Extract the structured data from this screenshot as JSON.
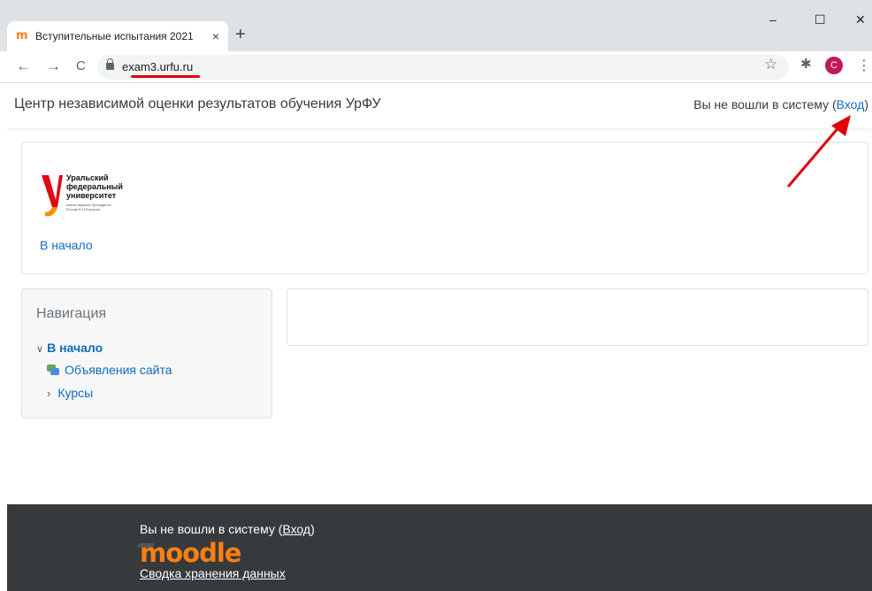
{
  "browser": {
    "tab_title": "Вступительные испытания 2021",
    "tab_favicon": "m",
    "url": "exam3.urfu.ru",
    "profile_initial": "C",
    "win_minimize": "–",
    "win_maximize": "☐",
    "win_close": "✕",
    "nav_back": "←",
    "nav_forward": "→",
    "nav_reload": "C",
    "new_tab": "+",
    "tab_close": "×",
    "star": "☆",
    "extensions": "✱",
    "menu": "⋮"
  },
  "header": {
    "site_title": "Центр независимой оценки результатов обучения УрФУ",
    "login_prefix": "Вы не вошли в систему (",
    "login_link": "Вход",
    "login_suffix": ")"
  },
  "hero": {
    "logo_line1": "Уральский",
    "logo_line2": "федеральный",
    "logo_line3": "университет",
    "logo_small1": "имени первого Президента",
    "logo_small2": "России Б.Н.Ельцина",
    "home_link": "В начало"
  },
  "navigation": {
    "title": "Навигация",
    "home": "В начало",
    "items": [
      {
        "label": "Объявления сайта"
      },
      {
        "label": "Курсы"
      }
    ]
  },
  "footer": {
    "login_prefix": "Вы не вошли в систему (",
    "login_link": "Вход",
    "login_suffix": ")",
    "moodle": "moodle",
    "data_link": "Сводка хранения данных"
  },
  "colors": {
    "link": "#0f6cbf",
    "footer_bg": "#373a3c",
    "moodle_orange": "#f98012",
    "annotation_red": "#e0000a"
  }
}
